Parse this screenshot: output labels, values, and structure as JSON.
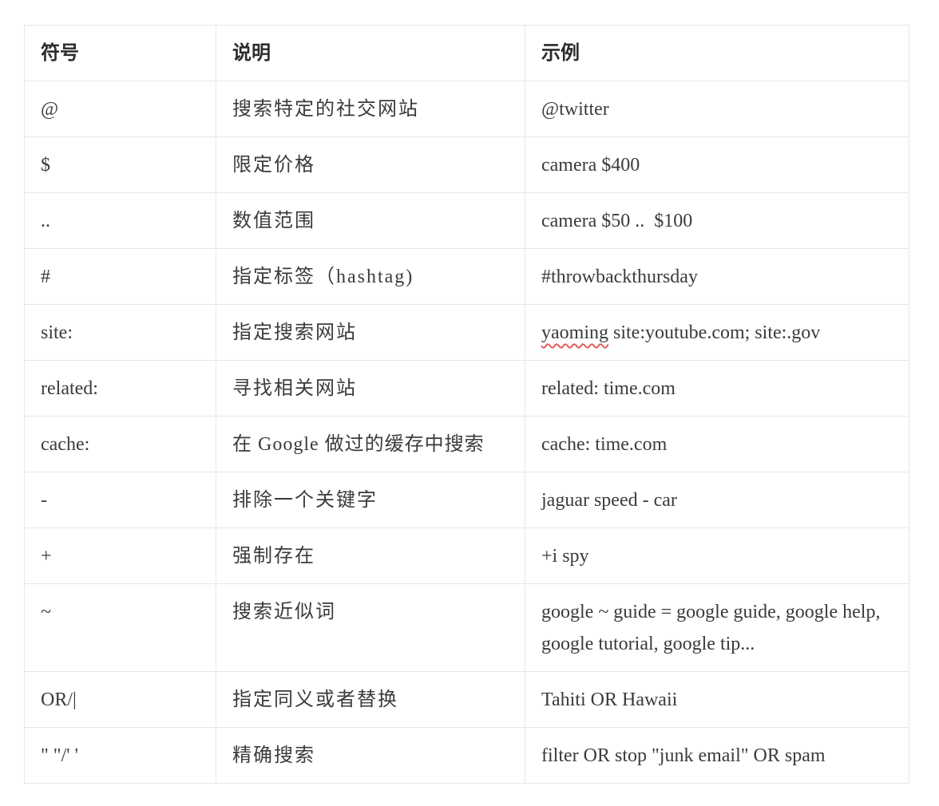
{
  "table": {
    "headers": [
      "符号",
      "说明",
      "示例"
    ],
    "rows": [
      {
        "symbol": "@",
        "description": "搜索特定的社交网站",
        "example": "@twitter"
      },
      {
        "symbol": "$",
        "description": "限定价格",
        "example": "camera $400"
      },
      {
        "symbol": "..",
        "description": "数值范围",
        "example": "camera $50 ..  $100"
      },
      {
        "symbol": "#",
        "description": "指定标签（hashtag)",
        "example": "#throwbackthursday"
      },
      {
        "symbol": "site:",
        "description": "指定搜索网站",
        "example_misspelled": "yaoming",
        "example_rest": " site:youtube.com; site:.gov"
      },
      {
        "symbol": "related:",
        "description": "寻找相关网站",
        "example": "related: time.com"
      },
      {
        "symbol": "cache:",
        "description": "在 Google 做过的缓存中搜索",
        "example": "cache: time.com"
      },
      {
        "symbol": "-",
        "description": "排除一个关键字",
        "example": "jaguar speed - car"
      },
      {
        "symbol": "+",
        "description": "强制存在",
        "example": "+i spy"
      },
      {
        "symbol": "~",
        "description": "搜索近似词",
        "example": "google ~ guide = google guide, google help, google tutorial, google tip..."
      },
      {
        "symbol": "OR/|",
        "description": "指定同义或者替换",
        "example": "Tahiti OR Hawaii"
      },
      {
        "symbol": "\" \"/' '",
        "description": "精确搜索",
        "example": "filter OR stop \"junk email\" OR spam"
      }
    ]
  },
  "colors": {
    "border": "#e6e6e6",
    "text": "#3b3b3b",
    "spellcheck": "#e0605e"
  }
}
